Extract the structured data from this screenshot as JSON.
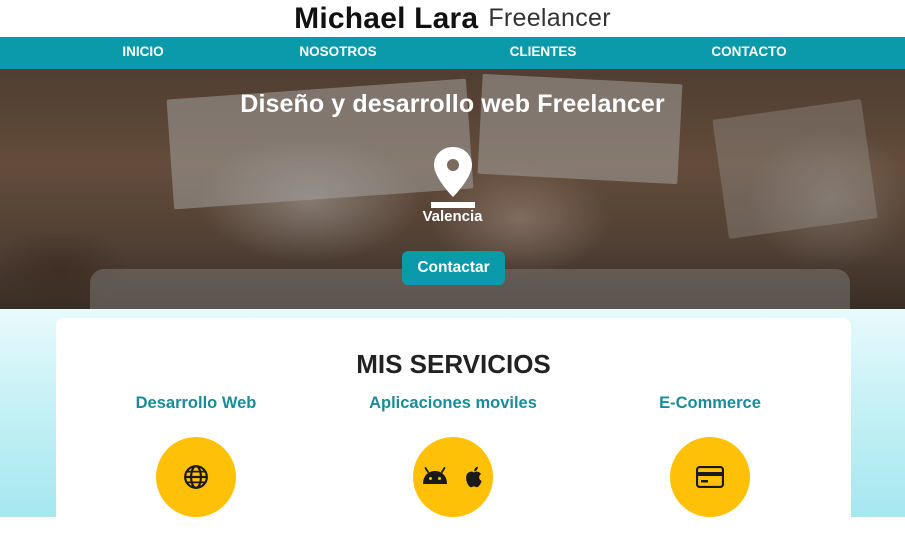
{
  "header": {
    "name": "Michael Lara",
    "role": "Freelancer"
  },
  "nav": {
    "items": [
      {
        "label": "INICIO"
      },
      {
        "label": "NOSOTROS"
      },
      {
        "label": "CLIENTES"
      },
      {
        "label": "CONTACTO"
      }
    ]
  },
  "hero": {
    "title": "Diseño y desarrollo web Freelancer",
    "location_icon": "map-pin-icon",
    "location": "Valencia",
    "button_label": "Contactar"
  },
  "services": {
    "title": "MIS SERVICIOS",
    "items": [
      {
        "name": "Desarrollo Web",
        "icons": [
          "globe-icon"
        ]
      },
      {
        "name": "Aplicaciones moviles",
        "icons": [
          "android-icon",
          "apple-icon"
        ]
      },
      {
        "name": "E-Commerce",
        "icons": [
          "credit-card-icon"
        ]
      }
    ]
  },
  "colors": {
    "accent": "#0a9aaa",
    "service_heading": "#1a8c9a",
    "icon_circle": "#ffc107",
    "services_background": "#b8edf4"
  }
}
